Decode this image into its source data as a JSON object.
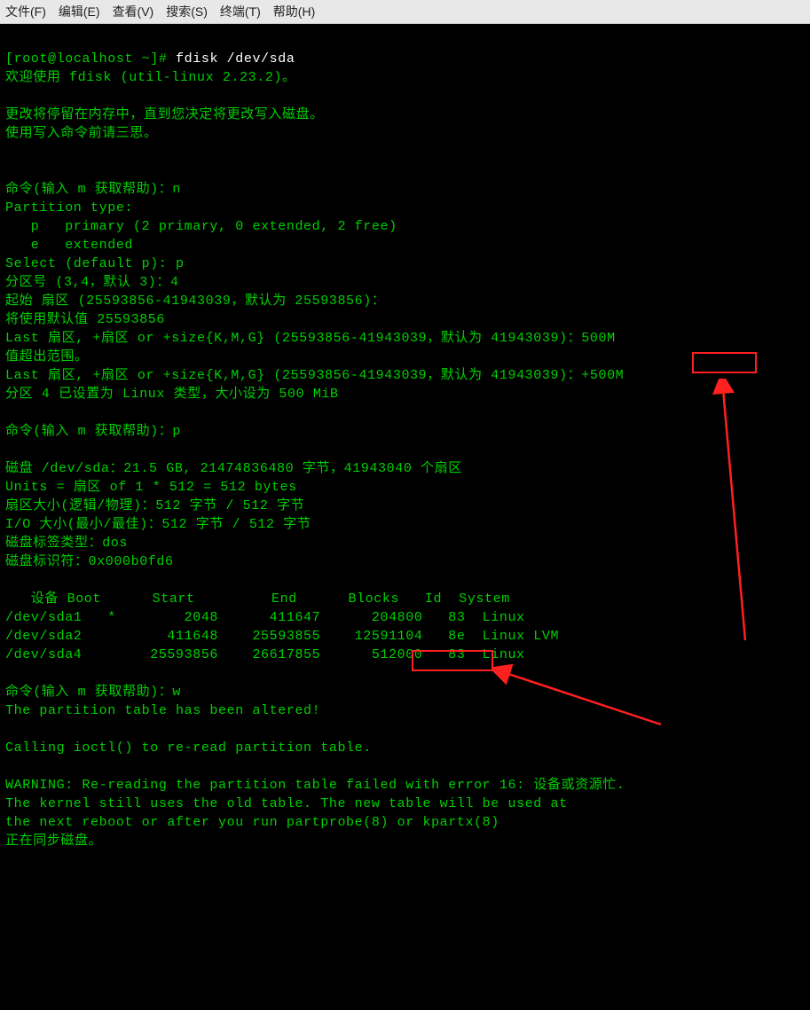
{
  "menubar": {
    "items": [
      "文件(F)",
      "编辑(E)",
      "查看(V)",
      "搜索(S)",
      "终端(T)",
      "帮助(H)"
    ]
  },
  "terminal": {
    "prompt_open": "[",
    "prompt_user": "root@localhost ~",
    "prompt_close": "]# ",
    "command": "fdisk /dev/sda",
    "lines": [
      "欢迎使用 fdisk (util-linux 2.23.2)。",
      "",
      "更改将停留在内存中，直到您决定将更改写入磁盘。",
      "使用写入命令前请三思。",
      "",
      "",
      "命令(输入 m 获取帮助)：n",
      "Partition type:",
      "   p   primary (2 primary, 0 extended, 2 free)",
      "   e   extended",
      "Select (default p): p",
      "分区号 (3,4，默认 3)：4",
      "起始 扇区 (25593856-41943039，默认为 25593856)：",
      "将使用默认值 25593856",
      "Last 扇区, +扇区 or +size{K,M,G} (25593856-41943039，默认为 41943039)：500M",
      "值超出范围。",
      "Last 扇区, +扇区 or +size{K,M,G} (25593856-41943039，默认为 41943039)：+500M",
      "分区 4 已设置为 Linux 类型，大小设为 500 MiB",
      "",
      "命令(输入 m 获取帮助)：p",
      "",
      "磁盘 /dev/sda：21.5 GB, 21474836480 字节，41943040 个扇区",
      "Units = 扇区 of 1 * 512 = 512 bytes",
      "扇区大小(逻辑/物理)：512 字节 / 512 字节",
      "I/O 大小(最小/最佳)：512 字节 / 512 字节",
      "磁盘标签类型：dos",
      "磁盘标识符：0x000b0fd6",
      "",
      "   设备 Boot      Start         End      Blocks   Id  System",
      "/dev/sda1   *        2048      411647      204800   83  Linux",
      "/dev/sda2          411648    25593855    12591104   8e  Linux LVM",
      "/dev/sda4        25593856    26617855      512000   83  Linux",
      "",
      "命令(输入 m 获取帮助)：w",
      "The partition table has been altered!",
      "",
      "Calling ioctl() to re-read partition table.",
      "",
      "WARNING: Re-reading the partition table failed with error 16: 设备或资源忙.",
      "The kernel still uses the old table. The new table will be used at",
      "the next reboot or after you run partprobe(8) or kpartx(8)",
      "正在同步磁盘。"
    ]
  }
}
